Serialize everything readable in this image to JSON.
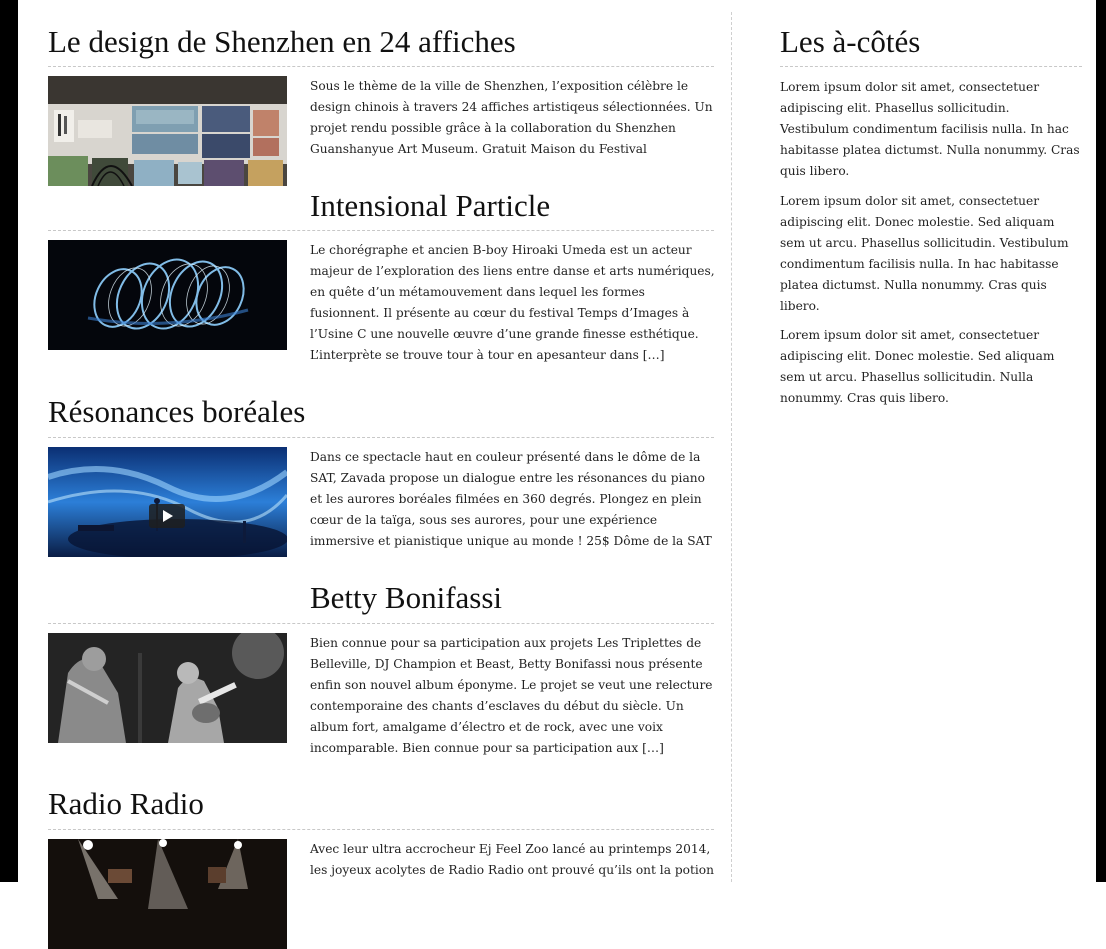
{
  "articles": [
    {
      "title": "Le design de Shenzhen en 24 affiches",
      "excerpt": "Sous le thème de la ville de Shenzhen, l’exposition célèbre le design chinois à travers 24 affiches artistiqeus sélectionnées. Un projet rendu possible grâce à la collaboration du Shenzhen Guanshanyue Art Museum. Gratuit Maison du Festival"
    },
    {
      "title": "Intensional Particle",
      "excerpt": "Le chorégraphe et ancien B-boy Hiroaki Umeda est un acteur majeur de l’exploration des liens entre danse et arts numériques, en quête d’un métamouvement dans lequel les formes fusionnent. Il présente au cœur du festival Temps d’Images à l’Usine C une nouvelle œuvre d’une grande finesse esthétique. L’interprète se trouve tour à tour en apesanteur dans […]"
    },
    {
      "title": "Résonances boréales",
      "excerpt": "Dans ce spectacle haut en couleur présenté dans le dôme de la SAT, Zavada propose un dialogue entre les résonances du piano et les aurores boréales filmées en 360 degrés. Plongez en plein cœur de la taïga, sous ses aurores, pour une expérience immersive et pianistique unique au monde ! 25$ Dôme de la SAT"
    },
    {
      "title": "Betty Bonifassi",
      "excerpt": "Bien connue pour sa participation aux projets Les Triplettes de Belleville, DJ Champion et Beast, Betty Bonifassi nous présente enfin son nouvel album éponyme. Le projet se veut une relecture contemporaine des chants d’esclaves du début du siècle. Un album fort, amalgame d’électro et de rock, avec une voix incomparable. Bien connue pour sa participation aux […]"
    },
    {
      "title": "Radio Radio",
      "excerpt": "Avec leur ultra accrocheur Ej Feel Zoo lancé au printemps 2014, les joyeux acolytes de Radio Radio ont prouvé qu’ils ont la potion"
    }
  ],
  "sidebar": {
    "title": "Les à-côtés",
    "paragraphs": [
      "Lorem ipsum dolor sit amet, consectetuer adipiscing elit. Phasellus sollicitudin. Vestibulum condimentum facilisis nulla. In hac habitasse platea dictumst. Nulla nonummy. Cras quis libero.",
      "Lorem ipsum dolor sit amet, consectetuer adipiscing elit. Donec molestie. Sed aliquam sem ut arcu. Phasellus sollicitudin. Vestibulum condimentum facilisis nulla. In hac habitasse platea dictumst. Nulla nonummy. Cras quis libero.",
      "Lorem ipsum dolor sit amet, consectetuer adipiscing elit. Donec molestie. Sed aliquam sem ut arcu. Phasellus sollicitudin. Nulla nonummy. Cras quis libero."
    ]
  }
}
